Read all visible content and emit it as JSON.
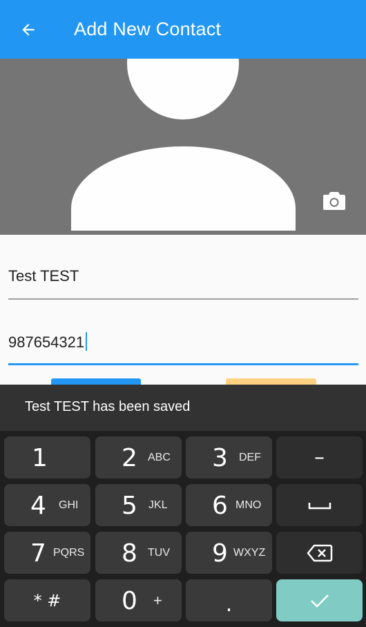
{
  "appbar": {
    "title": "Add New Contact",
    "back_icon": "arrow-left-icon",
    "color": "#2196f3"
  },
  "photo": {
    "camera_icon": "camera-icon",
    "background": "#757575"
  },
  "form": {
    "name_value": "Test TEST",
    "phone_value": "987654321"
  },
  "snackbar": {
    "message": "Test TEST has been saved"
  },
  "keyboard": {
    "keys": [
      {
        "main": "1",
        "sub": ""
      },
      {
        "main": "2",
        "sub": "ABC"
      },
      {
        "main": "3",
        "sub": "DEF"
      },
      {
        "main": "–",
        "sub": ""
      },
      {
        "main": "4",
        "sub": "GHI"
      },
      {
        "main": "5",
        "sub": "JKL"
      },
      {
        "main": "6",
        "sub": "MNO"
      },
      {
        "main": "space",
        "sub": ""
      },
      {
        "main": "7",
        "sub": "PQRS"
      },
      {
        "main": "8",
        "sub": "TUV"
      },
      {
        "main": "9",
        "sub": "WXYZ"
      },
      {
        "main": "backspace",
        "sub": ""
      },
      {
        "main": "* #",
        "sub": ""
      },
      {
        "main": "0",
        "sub": "+"
      },
      {
        "main": ".",
        "sub": ""
      },
      {
        "main": "done",
        "sub": ""
      }
    ],
    "done_color": "#80cbc4"
  }
}
